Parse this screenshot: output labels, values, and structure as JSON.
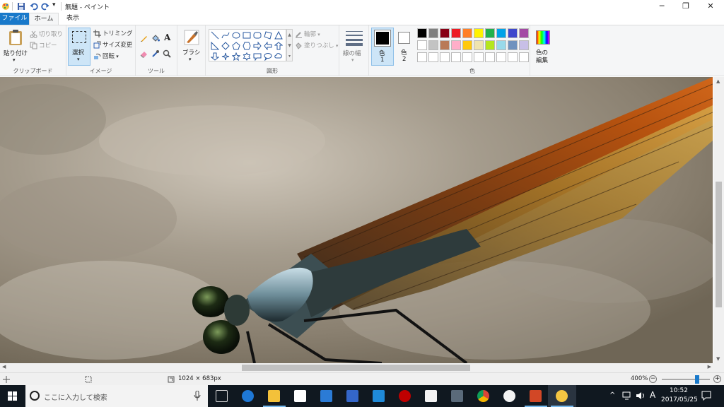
{
  "window": {
    "title": "無題 - ペイント",
    "qa_dropdown": "▾",
    "minimize": "─",
    "maximize": "❐",
    "close": "✕"
  },
  "tabs": [
    {
      "label": "ファイル",
      "active": false,
      "file": true
    },
    {
      "label": "ホーム",
      "active": true
    },
    {
      "label": "表示",
      "active": false
    }
  ],
  "ribbon": {
    "clipboard": {
      "paste": "貼り付け",
      "cut": "切り取り",
      "copy": "コピー",
      "group": "クリップボード"
    },
    "image": {
      "select": "選択",
      "crop": "トリミング",
      "resize": "サイズ変更",
      "rotate": "回転",
      "group": "イメージ"
    },
    "tools": {
      "group": "ツール"
    },
    "brushes": {
      "label": "ブラシ"
    },
    "shapes": {
      "outline": "輪郭",
      "fill": "塗りつぶし",
      "group": "図形"
    },
    "size": {
      "label": "線の幅"
    },
    "color1": {
      "label1": "色",
      "label2": "1"
    },
    "color2": {
      "label1": "色",
      "label2": "2"
    },
    "colors": {
      "group": "色"
    },
    "edit_colors": {
      "label1": "色の",
      "label2": "編集"
    },
    "palette_row1": [
      "#000000",
      "#7f7f7f",
      "#880015",
      "#ed1c24",
      "#ff7f27",
      "#fff200",
      "#22b14c",
      "#00a2e8",
      "#3f48cc",
      "#a349a4"
    ],
    "palette_row2": [
      "#ffffff",
      "#c3c3c3",
      "#b97a57",
      "#ffaec9",
      "#ffc90e",
      "#efe4b0",
      "#b5e61d",
      "#99d9ea",
      "#7092be",
      "#c8bfe7"
    ],
    "palette_row3": [
      "#ffffff",
      "#ffffff",
      "#ffffff",
      "#ffffff",
      "#ffffff",
      "#ffffff",
      "#ffffff",
      "#ffffff",
      "#ffffff",
      "#ffffff"
    ]
  },
  "status": {
    "image_size": "1024 × 683px",
    "zoom": "400%",
    "zoom_level": 0.75
  },
  "taskbar": {
    "search_placeholder": "ここに入力して検索",
    "time": "10:52",
    "date": "2017/05/25",
    "ime": "A",
    "apps": [
      "task-view",
      "edge",
      "explorer",
      "store",
      "mail",
      "app-grid",
      "photos",
      "rakuten",
      "amazon",
      "calculator",
      "chrome",
      "itunes",
      "powerpoint",
      "paint"
    ]
  },
  "colors": {
    "file_tab": "#1979ca",
    "taskbar": "#101820",
    "accent": "#76b9ed"
  }
}
